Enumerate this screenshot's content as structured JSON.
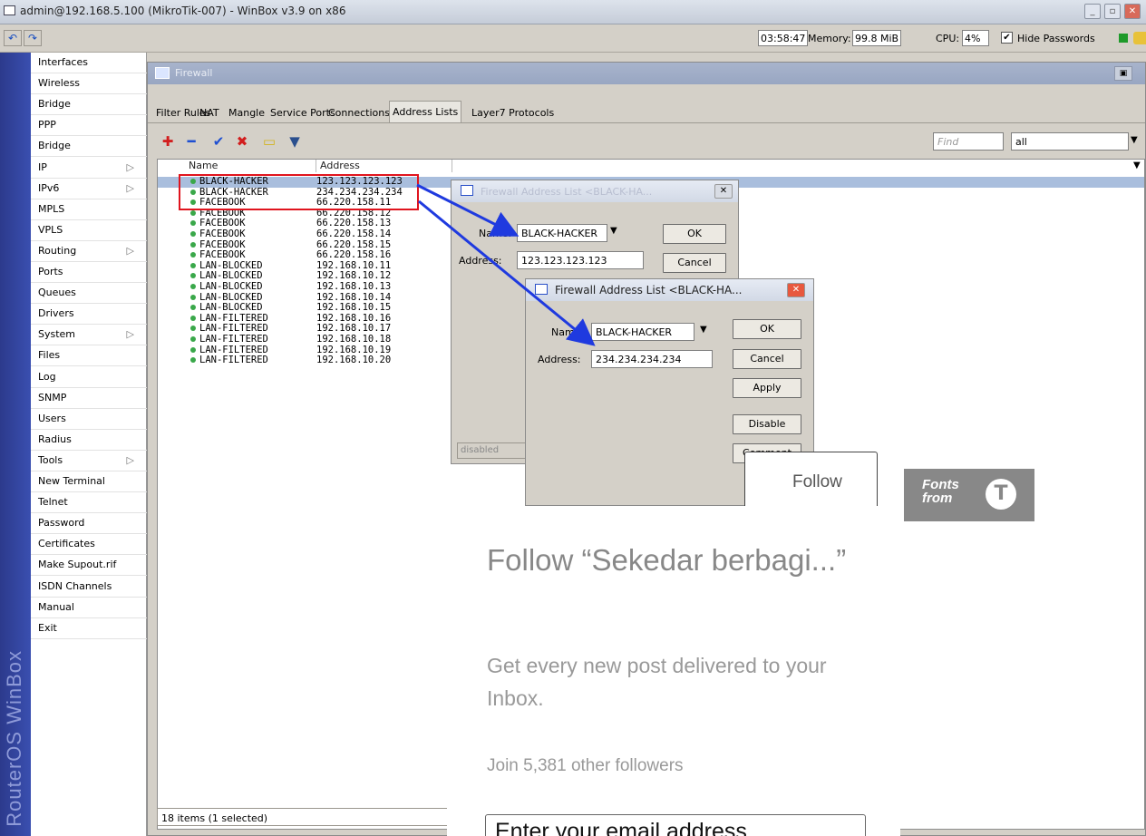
{
  "window": {
    "title": "admin@192.168.5.100 (MikroTik-007) - WinBox v3.9 on x86"
  },
  "toolbar": {
    "undo_icon": "undo-icon",
    "redo_icon": "redo-icon",
    "time": "03:58:47",
    "memory_label": "Memory:",
    "memory_value": "99.8 MiB",
    "cpu_label": "CPU:",
    "cpu_value": "4%",
    "hide_passwords_label": "Hide Passwords",
    "hide_passwords_checked": true
  },
  "sidebar": {
    "brand": "RouterOS WinBox",
    "items": [
      {
        "label": "Interfaces",
        "submenu": false
      },
      {
        "label": "Wireless",
        "submenu": false
      },
      {
        "label": "Bridge",
        "submenu": false
      },
      {
        "label": "PPP",
        "submenu": false
      },
      {
        "label": "Bridge",
        "submenu": false
      },
      {
        "label": "IP",
        "submenu": true
      },
      {
        "label": "IPv6",
        "submenu": true
      },
      {
        "label": "MPLS",
        "submenu": false
      },
      {
        "label": "VPLS",
        "submenu": false
      },
      {
        "label": "Routing",
        "submenu": true
      },
      {
        "label": "Ports",
        "submenu": false
      },
      {
        "label": "Queues",
        "submenu": false
      },
      {
        "label": "Drivers",
        "submenu": false
      },
      {
        "label": "System",
        "submenu": true
      },
      {
        "label": "Files",
        "submenu": false
      },
      {
        "label": "Log",
        "submenu": false
      },
      {
        "label": "SNMP",
        "submenu": false
      },
      {
        "label": "Users",
        "submenu": false
      },
      {
        "label": "Radius",
        "submenu": false
      },
      {
        "label": "Tools",
        "submenu": true
      },
      {
        "label": "New Terminal",
        "submenu": false
      },
      {
        "label": "Telnet",
        "submenu": false
      },
      {
        "label": "Password",
        "submenu": false
      },
      {
        "label": "Certificates",
        "submenu": false
      },
      {
        "label": "Make Supout.rif",
        "submenu": false
      },
      {
        "label": "ISDN Channels",
        "submenu": false
      },
      {
        "label": "Manual",
        "submenu": false
      },
      {
        "label": "Exit",
        "submenu": false
      }
    ]
  },
  "firewall": {
    "title": "Firewall",
    "tabs": [
      "Filter Rules",
      "NAT",
      "Mangle",
      "Service Ports",
      "Connections",
      "Address Lists",
      "Layer7 Protocols"
    ],
    "active_tab": "Address Lists",
    "find_placeholder": "Find",
    "filter_value": "all",
    "columns": {
      "name": "Name",
      "address": "Address"
    },
    "rows": [
      {
        "name": "BLACK-HACKER",
        "address": "123.123.123.123",
        "selected": true
      },
      {
        "name": "BLACK-HACKER",
        "address": "234.234.234.234",
        "selected": false
      },
      {
        "name": "FACEBOOK",
        "address": "66.220.158.11",
        "selected": false
      },
      {
        "name": "FACEBOOK",
        "address": "66.220.158.12",
        "selected": false
      },
      {
        "name": "FACEBOOK",
        "address": "66.220.158.13",
        "selected": false
      },
      {
        "name": "FACEBOOK",
        "address": "66.220.158.14",
        "selected": false
      },
      {
        "name": "FACEBOOK",
        "address": "66.220.158.15",
        "selected": false
      },
      {
        "name": "FACEBOOK",
        "address": "66.220.158.16",
        "selected": false
      },
      {
        "name": "LAN-BLOCKED",
        "address": "192.168.10.11",
        "selected": false
      },
      {
        "name": "LAN-BLOCKED",
        "address": "192.168.10.12",
        "selected": false
      },
      {
        "name": "LAN-BLOCKED",
        "address": "192.168.10.13",
        "selected": false
      },
      {
        "name": "LAN-BLOCKED",
        "address": "192.168.10.14",
        "selected": false
      },
      {
        "name": "LAN-BLOCKED",
        "address": "192.168.10.15",
        "selected": false
      },
      {
        "name": "LAN-FILTERED",
        "address": "192.168.10.16",
        "selected": false
      },
      {
        "name": "LAN-FILTERED",
        "address": "192.168.10.17",
        "selected": false
      },
      {
        "name": "LAN-FILTERED",
        "address": "192.168.10.18",
        "selected": false
      },
      {
        "name": "LAN-FILTERED",
        "address": "192.168.10.19",
        "selected": false
      },
      {
        "name": "LAN-FILTERED",
        "address": "192.168.10.20",
        "selected": false
      }
    ],
    "status": "18 items (1 selected)"
  },
  "dialog1": {
    "title": "Firewall Address List <BLACK-HA...",
    "name_label": "Name:",
    "name_value": "BLACK-HACKER",
    "address_label": "Address:",
    "address_value": "123.123.123.123",
    "ok": "OK",
    "cancel": "Cancel",
    "status": "disabled"
  },
  "dialog2": {
    "title": "Firewall Address List <BLACK-HA...",
    "name_label": "Name:",
    "name_value": "BLACK-HACKER",
    "address_label": "Address:",
    "address_value": "234.234.234.234",
    "ok": "OK",
    "cancel": "Cancel",
    "apply": "Apply",
    "disable": "Disable",
    "comment": "Comment"
  },
  "follow": {
    "tab_label": "Follow",
    "heading": "Follow “Sekedar berbagi...”",
    "description": "Get every new post delivered to your Inbox.",
    "followers": "Join 5,381 other followers",
    "email_placeholder": "Enter your email address"
  },
  "fonts_badge": {
    "text": "Fonts from"
  },
  "colors": {
    "strip": "#3246a8",
    "selection": "#a9bedd",
    "highlight_box": "#e0141e",
    "arrow": "#1f3adf",
    "status_dot": "#3aa84a"
  }
}
